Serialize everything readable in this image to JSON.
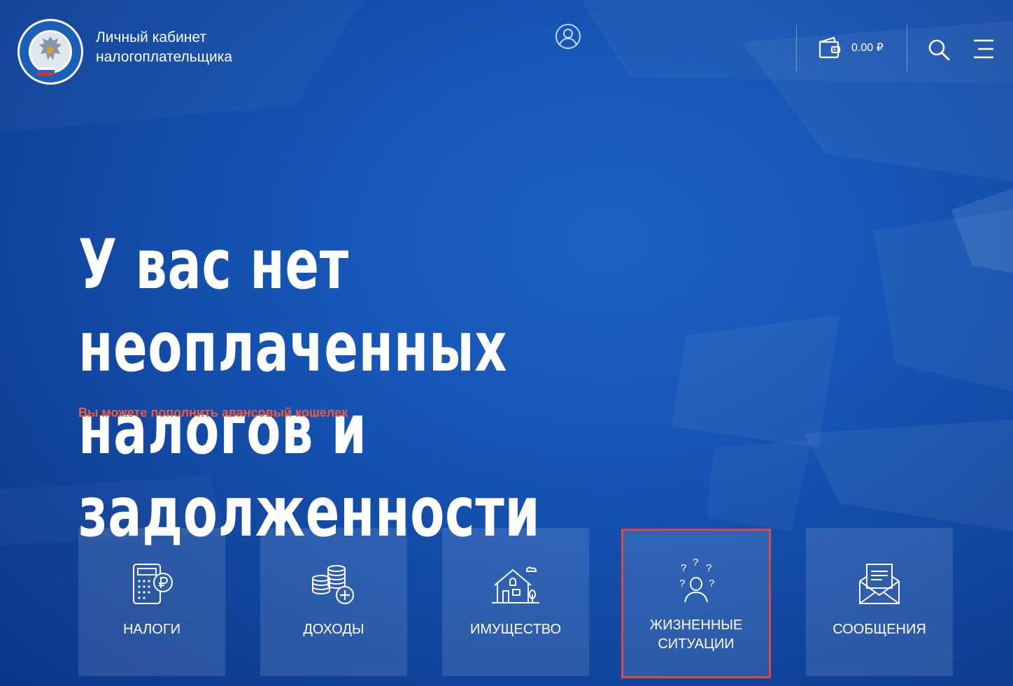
{
  "header": {
    "title": "Личный кабинет налогоплательщика",
    "wallet_amount": "0.00 ₽"
  },
  "hero": {
    "headline": "У вас нет неоплаченных налогов и задолженности",
    "topup_link": "Вы можете пополнить авансовый кошелек"
  },
  "tiles": [
    {
      "label": "НАЛОГИ",
      "icon": "calculator-ruble-icon"
    },
    {
      "label": "ДОХОДЫ",
      "icon": "coins-plus-icon"
    },
    {
      "label": "ИМУЩЕСТВО",
      "icon": "house-icon"
    },
    {
      "label": "ЖИЗНЕННЫЕ СИТУАЦИИ",
      "icon": "person-questions-icon",
      "highlighted": true
    },
    {
      "label": "СООБЩЕНИЯ",
      "icon": "envelope-letter-icon"
    }
  ],
  "colors": {
    "background": "#1553b3",
    "accent_link": "#ee5a3b",
    "highlight_border": "#e0483c"
  }
}
